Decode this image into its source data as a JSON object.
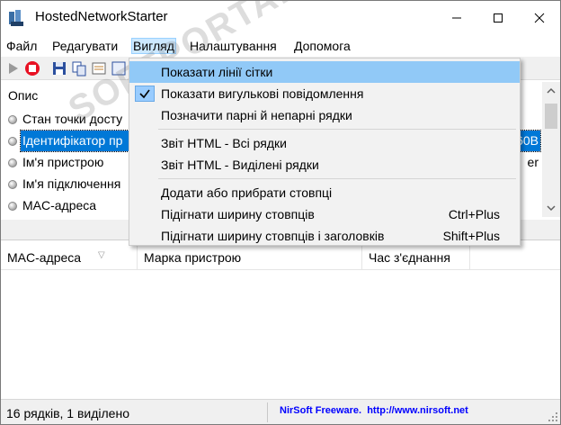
{
  "window": {
    "title": "HostedNetworkStarter",
    "controls": {
      "minimize": "minimize",
      "maximize": "maximize",
      "close": "close"
    }
  },
  "menubar": {
    "items": [
      "Файл",
      "Редагувати",
      "Вигляд",
      "Налаштування",
      "Допомога"
    ]
  },
  "upper_list": {
    "header": "Опис",
    "rows": [
      {
        "label": "Стан точки досту",
        "value": ""
      },
      {
        "label": "Ідентифікатор пр",
        "value": "60B"
      },
      {
        "label": "Ім'я пристрою",
        "value": "er"
      },
      {
        "label": "Ім'я підключення",
        "value": ""
      },
      {
        "label": "MAC-адреса",
        "value": ""
      }
    ]
  },
  "lower_list": {
    "columns": [
      "MAC-адреса",
      "Марка пристрою",
      "Час з'єднання"
    ]
  },
  "dropdown": {
    "items": [
      {
        "label": "Показати лінії сітки",
        "shortcut": "",
        "checked": false
      },
      {
        "label": "Показати вигулькові повідомлення",
        "shortcut": "",
        "checked": true
      },
      {
        "label": "Позначити парні й непарні рядки",
        "shortcut": "",
        "checked": false
      },
      {
        "label": "Звіт HTML - Всі рядки",
        "shortcut": "",
        "checked": false
      },
      {
        "label": "Звіт HTML - Виділені рядки",
        "shortcut": "",
        "checked": false
      },
      {
        "label": "Додати або прибрати стовпці",
        "shortcut": "",
        "checked": false
      },
      {
        "label": "Підігнати ширину стовпців",
        "shortcut": "Ctrl+Plus",
        "checked": false
      },
      {
        "label": "Підігнати ширину стовпців і заголовків",
        "shortcut": "Shift+Plus",
        "checked": false
      }
    ]
  },
  "statusbar": {
    "left": "16 рядків, 1 виділено",
    "link": "NirSoft Freeware.  http://www.nirsoft.net"
  },
  "watermark": "SOFTPORTAL",
  "colors": {
    "selection": "#0078d7",
    "menu_bg": "#f2f2f2",
    "link": "#0000ff",
    "stop": "#e81123"
  },
  "icons": [
    "app-icon",
    "play-icon",
    "stop-icon",
    "save-icon",
    "copy-icon",
    "properties-icon",
    "refresh-icon",
    "check-icon",
    "sort-icon",
    "size-grip-icon"
  ]
}
